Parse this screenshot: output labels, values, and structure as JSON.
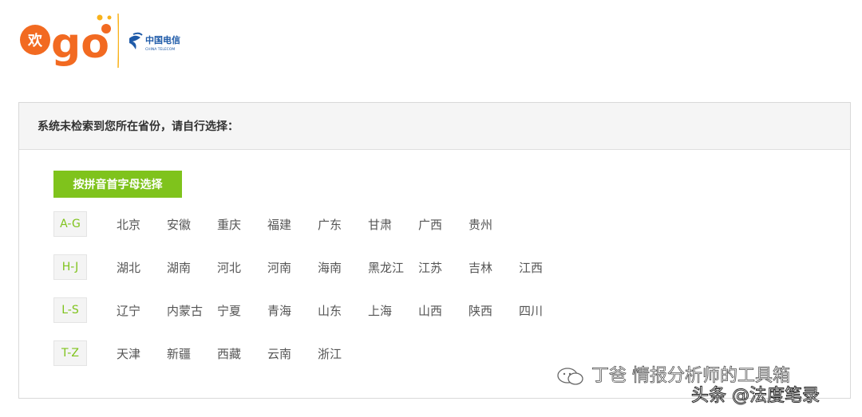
{
  "header": {
    "ego_logo_text": "欢go",
    "carrier_logo_cn": "中国电信",
    "carrier_logo_en": "CHINA TELECOM"
  },
  "panel": {
    "title": "系统未检索到您所在省份，请自行选择：",
    "pinyin_button": "按拼音首字母选择"
  },
  "groups": [
    {
      "label": "A-G",
      "provinces": [
        "北京",
        "安徽",
        "重庆",
        "福建",
        "广东",
        "甘肃",
        "广西",
        "贵州"
      ]
    },
    {
      "label": "H-J",
      "provinces": [
        "湖北",
        "湖南",
        "河北",
        "河南",
        "海南",
        "黑龙江",
        "江苏",
        "吉林",
        "江西"
      ]
    },
    {
      "label": "L-S",
      "provinces": [
        "辽宁",
        "内蒙古",
        "宁夏",
        "青海",
        "山东",
        "上海",
        "山西",
        "陕西",
        "四川"
      ]
    },
    {
      "label": "T-Z",
      "provinces": [
        "天津",
        "新疆",
        "西藏",
        "云南",
        "浙江"
      ]
    }
  ],
  "watermarks": {
    "wechat": "丁爸 情报分析师的工具箱",
    "toutiao": "头条 @法度笔录"
  },
  "colors": {
    "accent": "#7fc31c",
    "logo_orange": "#f26a21"
  }
}
